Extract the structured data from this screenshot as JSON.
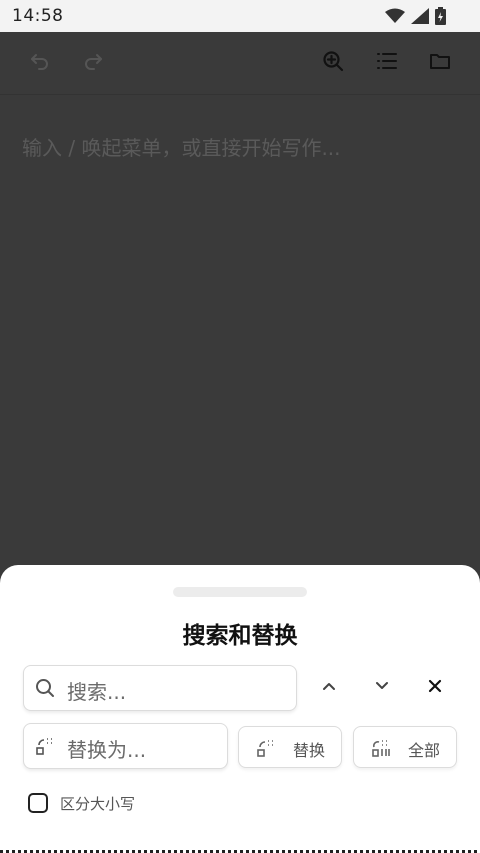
{
  "status_bar": {
    "time": "14:58",
    "icons": [
      "wifi-icon",
      "signal-icon",
      "battery-icon"
    ]
  },
  "toolbar": {
    "buttons": [
      "undo-icon",
      "redo-icon",
      "search-icon",
      "outline-list-icon",
      "folder-icon"
    ]
  },
  "editor": {
    "placeholder": "输入 / 唤起菜单，或直接开始写作..."
  },
  "search_sheet": {
    "title": "搜索和替换",
    "search_placeholder": "搜索...",
    "replace_placeholder": "替换为...",
    "replace_button": "替换",
    "replace_all_button": "全部",
    "case_sensitive_label": "区分大小写",
    "case_sensitive_checked": false
  },
  "colors": {
    "editor_background": "#3a3a3a",
    "sheet_background": "#ffffff",
    "status_bar_background": "#f3f3f3"
  }
}
